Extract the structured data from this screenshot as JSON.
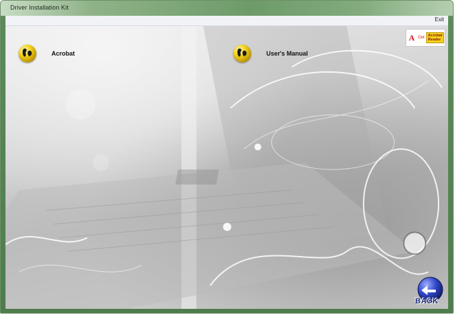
{
  "window": {
    "title": "Driver Installation Kit"
  },
  "menubar": {
    "exit_label": "Exit"
  },
  "items": [
    {
      "label": "Acrobat",
      "icon": "globe-icon"
    },
    {
      "label": "User's Manual",
      "icon": "globe-icon"
    }
  ],
  "adobe_badge": {
    "get_text": "Get",
    "reader_text_line1": "Acrobat",
    "reader_text_line2": "Reader"
  },
  "back_button": {
    "label": "BACK"
  },
  "colors": {
    "frame": "#5c8a58",
    "accent_yellow": "#f2d21a",
    "back_blue": "#2a3fb8"
  }
}
